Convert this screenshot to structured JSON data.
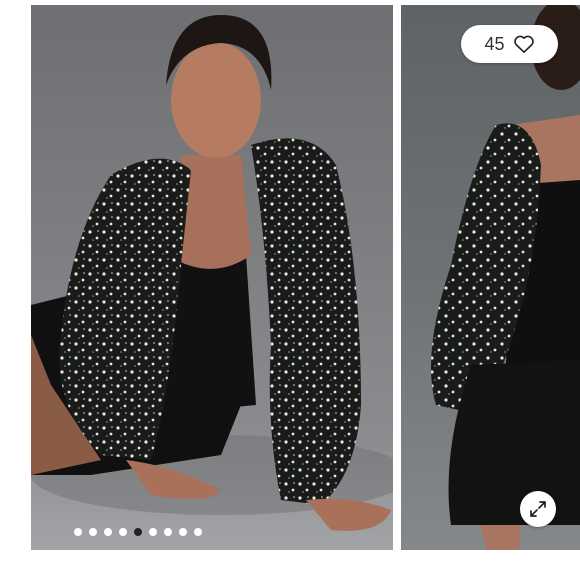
{
  "gallery": {
    "like_count": "45",
    "heart_icon": "heart-outline-icon",
    "expand_icon": "expand-diagonal-icon",
    "slides_total": 9,
    "slide_active_index": 4
  }
}
